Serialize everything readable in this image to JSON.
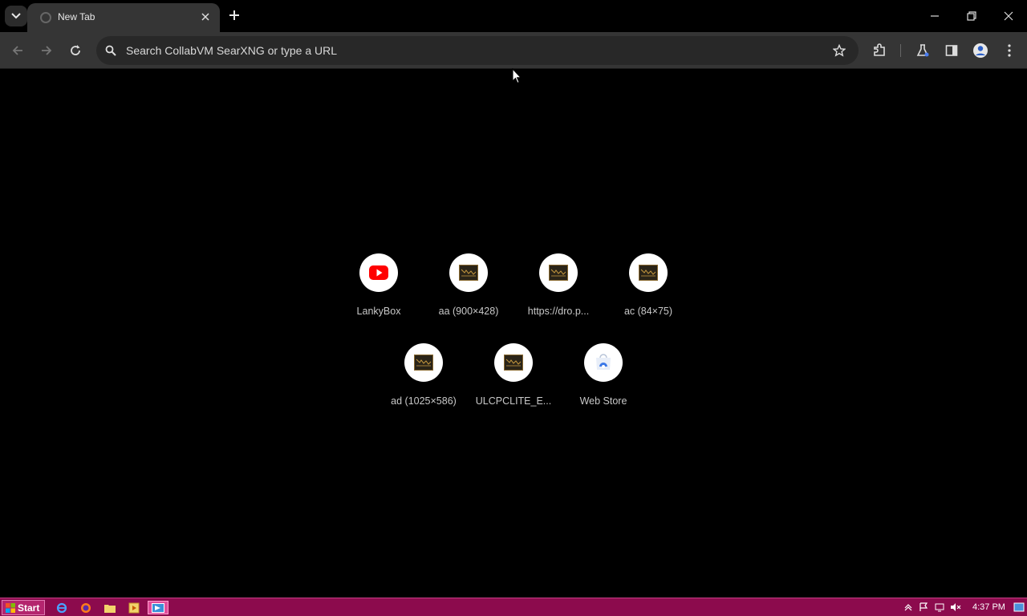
{
  "browser": {
    "tab": {
      "title": "New Tab"
    },
    "omnibox": {
      "placeholder": "Search CollabVM SearXNG or type a URL"
    }
  },
  "shortcuts": [
    {
      "label": "LankyBox",
      "icon": "youtube-icon"
    },
    {
      "label": "aa (900×428)",
      "icon": "image-thumbnail-icon"
    },
    {
      "label": "https://dro.p...",
      "icon": "image-thumbnail-icon"
    },
    {
      "label": "ac (84×75)",
      "icon": "image-thumbnail-icon"
    },
    {
      "label": "ad (1025×586)",
      "icon": "image-thumbnail-icon"
    },
    {
      "label": "ULCPCLITE_E...",
      "icon": "image-thumbnail-icon"
    },
    {
      "label": "Web Store",
      "icon": "web-store-icon"
    }
  ],
  "taskbar": {
    "start_label": "Start",
    "clock": "4:37 PM",
    "color": "#8c0b4d"
  }
}
